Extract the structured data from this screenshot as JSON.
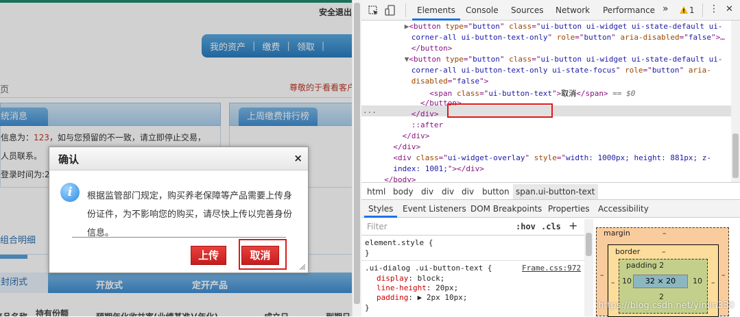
{
  "page": {
    "logout": "安全退出",
    "topnav": [
      "我的资产",
      "缴费",
      "领取"
    ],
    "breadcrumb": "页",
    "welcome": "尊敬的于看看客户",
    "panel1": {
      "tab": "统消息",
      "line1_pre": "信息为：",
      "line1_num": "123",
      "line1_post": "，如与您预留的不一致，请立即停止交易，",
      "line2": "人员联系。",
      "line3": "登录时间为:2"
    },
    "panel2": {
      "tab": "上周缴费排行榜"
    },
    "subtab": "组合明细",
    "tabs2": [
      "封闭式",
      "开放式",
      "定开产品"
    ],
    "thead": [
      "产品名称",
      "持有份额",
      "预期年化收益率(业绩基准)(年化)",
      "成立日",
      "到期日"
    ]
  },
  "dialog": {
    "title": "确认",
    "close": "×",
    "info_glyph": "i",
    "message": "根据监管部门规定，购买养老保障等产品需要上传身份证件，为不影响您的购买，请尽快上传以完善身份信息。",
    "upload_button": "上传",
    "cancel_button": "取消"
  },
  "devtools": {
    "tabs": [
      "Elements",
      "Console",
      "Sources",
      "Network",
      "Performance"
    ],
    "more": "»",
    "warning_count": "1",
    "warning_icon": "warning-icon",
    "menu": "⋮",
    "close": "✕",
    "code_lines": [
      {
        "indent": 8,
        "parts": [
          [
            "tri",
            "▶"
          ],
          [
            "tag",
            "<button "
          ],
          [
            "attr",
            "type"
          ],
          [
            "tag",
            "=\""
          ],
          [
            "val",
            "button"
          ],
          [
            "tag",
            "\" "
          ],
          [
            "attr",
            "class"
          ],
          [
            "tag",
            "=\""
          ],
          [
            "val",
            "ui-button ui-widget ui-state-default ui-"
          ],
          [
            "tag",
            ""
          ]
        ]
      },
      {
        "indent": 8,
        "parts": [
          [
            "val",
            "corner-all ui-button-text-only"
          ],
          [
            "tag",
            "\" "
          ],
          [
            "attr",
            "role"
          ],
          [
            "tag",
            "=\""
          ],
          [
            "val",
            "button"
          ],
          [
            "tag",
            "\" "
          ],
          [
            "attr",
            "aria-disabled"
          ],
          [
            "tag",
            "=\""
          ],
          [
            "val",
            "false"
          ],
          [
            "tag",
            "\">…"
          ]
        ]
      },
      {
        "indent": 8,
        "parts": [
          [
            "tag",
            "</button>"
          ]
        ]
      },
      {
        "indent": 8,
        "parts": [
          [
            "tri",
            "▼"
          ],
          [
            "tag",
            "<button "
          ],
          [
            "attr",
            "type"
          ],
          [
            "tag",
            "=\""
          ],
          [
            "val",
            "button"
          ],
          [
            "tag",
            "\" "
          ],
          [
            "attr",
            "class"
          ],
          [
            "tag",
            "=\""
          ],
          [
            "val",
            "ui-button ui-widget ui-state-default ui-"
          ]
        ]
      },
      {
        "indent": 8,
        "parts": [
          [
            "val",
            "corner-all ui-button-text-only ui-state-focus"
          ],
          [
            "tag",
            "\" "
          ],
          [
            "attr",
            "role"
          ],
          [
            "tag",
            "=\""
          ],
          [
            "val",
            "button"
          ],
          [
            "tag",
            "\" "
          ],
          [
            "attr",
            "aria-"
          ]
        ]
      },
      {
        "indent": 8,
        "parts": [
          [
            "attr",
            "disabled"
          ],
          [
            "tag",
            "=\""
          ],
          [
            "val",
            "false"
          ],
          [
            "tag",
            "\">"
          ]
        ]
      },
      {
        "indent": 12,
        "sel": true,
        "parts": [
          [
            "tag",
            "<span "
          ],
          [
            "attr",
            "class"
          ],
          [
            "tag",
            "=\""
          ],
          [
            "val",
            "ui-button-text"
          ],
          [
            "tag",
            "\">"
          ],
          [
            "txt",
            "取消"
          ],
          [
            "tag",
            "</span>"
          ],
          [
            "pse",
            " == $0"
          ]
        ]
      },
      {
        "indent": 10,
        "parts": [
          [
            "tag",
            "</button>"
          ]
        ]
      },
      {
        "indent": 8,
        "parts": [
          [
            "tag",
            "</div>"
          ]
        ]
      },
      {
        "indent": 8,
        "parts": [
          [
            "pse",
            "::after"
          ]
        ]
      },
      {
        "indent": 6,
        "parts": [
          [
            "tag",
            "</div>"
          ]
        ]
      },
      {
        "indent": 4,
        "parts": [
          [
            "tag",
            "</div>"
          ]
        ]
      },
      {
        "indent": 4,
        "parts": [
          [
            "tag",
            "<div "
          ],
          [
            "attr",
            "class"
          ],
          [
            "tag",
            "=\""
          ],
          [
            "val",
            "ui-widget-overlay"
          ],
          [
            "tag",
            "\" "
          ],
          [
            "attr",
            "style"
          ],
          [
            "tag",
            "=\""
          ],
          [
            "val",
            "width: 1000px; height: 881px; z-"
          ]
        ]
      },
      {
        "indent": 4,
        "parts": [
          [
            "val",
            "index: 1001;"
          ],
          [
            "tag",
            "\"></div>"
          ]
        ]
      },
      {
        "indent": 2,
        "parts": [
          [
            "tag",
            "</body>"
          ]
        ]
      }
    ],
    "breadcrumbs": [
      "html",
      "body",
      "div",
      "div",
      "div",
      "button",
      "span.ui-button-text"
    ],
    "subtabs": [
      "Styles",
      "Event Listeners",
      "DOM Breakpoints",
      "Properties",
      "Accessibility"
    ],
    "filter_placeholder": "Filter",
    "hov": ":hov",
    "cls": ".cls",
    "plus": "+",
    "styles": {
      "element_style": "element.style {",
      "close_brace": "}",
      "rule_selector": ".ui-dialog .ui-button-text {",
      "rule_source": "Frame.css:972",
      "props": [
        [
          "display",
          "block;"
        ],
        [
          "line-height",
          "20px;"
        ],
        [
          "padding",
          "▶ 2px 10px;"
        ]
      ]
    },
    "boxmodel": {
      "margin_label": "margin",
      "margin_val": "–",
      "border_label": "border",
      "border_val": "–",
      "padding_label": "padding 2",
      "content": "32 × 20",
      "left": "10",
      "right": "10",
      "bottom": "2",
      "side_dash": "–"
    },
    "watermark": "https://blog.csdn.net/yinlin330"
  }
}
